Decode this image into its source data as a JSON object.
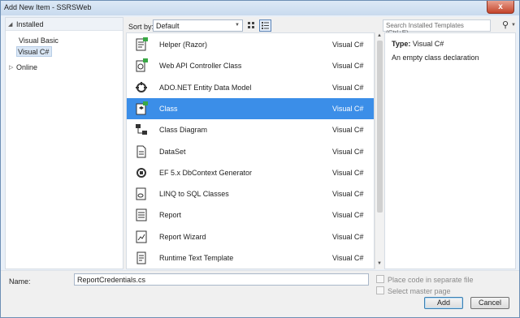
{
  "window": {
    "title": "Add New Item - SSRSWeb",
    "close_label": "x"
  },
  "tree": {
    "installed": "Installed",
    "items": [
      "Visual Basic",
      "Visual C#"
    ],
    "online": "Online"
  },
  "toolbar": {
    "sort_label": "Sort by:",
    "sort_value": "Default",
    "search_placeholder": "Search Installed Templates (Ctrl+E)"
  },
  "templates": [
    {
      "name": "Helper (Razor)",
      "language": "Visual C#",
      "icon": "razor-helper-icon",
      "selected": false
    },
    {
      "name": "Web API Controller Class",
      "language": "Visual C#",
      "icon": "web-api-controller-icon",
      "selected": false
    },
    {
      "name": "ADO.NET Entity Data Model",
      "language": "Visual C#",
      "icon": "entity-data-model-icon",
      "selected": false
    },
    {
      "name": "Class",
      "language": "Visual C#",
      "icon": "class-icon",
      "selected": true
    },
    {
      "name": "Class Diagram",
      "language": "Visual C#",
      "icon": "class-diagram-icon",
      "selected": false
    },
    {
      "name": "DataSet",
      "language": "Visual C#",
      "icon": "dataset-icon",
      "selected": false
    },
    {
      "name": "EF 5.x DbContext Generator",
      "language": "Visual C#",
      "icon": "dbcontext-generator-icon",
      "selected": false
    },
    {
      "name": "LINQ to SQL Classes",
      "language": "Visual C#",
      "icon": "linq-to-sql-icon",
      "selected": false
    },
    {
      "name": "Report",
      "language": "Visual C#",
      "icon": "report-icon",
      "selected": false
    },
    {
      "name": "Report Wizard",
      "language": "Visual C#",
      "icon": "report-wizard-icon",
      "selected": false
    },
    {
      "name": "Runtime Text Template",
      "language": "Visual C#",
      "icon": "text-template-icon",
      "selected": false
    }
  ],
  "details": {
    "type_label": "Type:",
    "type_value": "Visual C#",
    "description": "An empty class declaration"
  },
  "bottom": {
    "name_label": "Name:",
    "name_value": "ReportCredentials.cs",
    "place_code_label": "Place code in separate file",
    "select_master_label": "Select master page",
    "add_label": "Add",
    "cancel_label": "Cancel"
  },
  "colors": {
    "selection": "#3b8ee8",
    "accent": "#3c7fb1"
  }
}
